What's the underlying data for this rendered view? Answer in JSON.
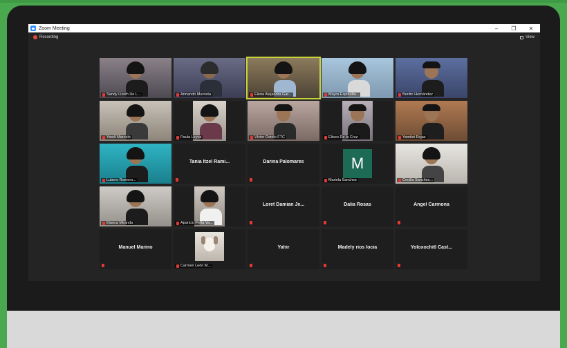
{
  "window": {
    "title": "Zoom Meeting",
    "min": "–",
    "max": "❐",
    "close": "✕"
  },
  "toolbar": {
    "recording": "Recording",
    "view": "View"
  },
  "participants": [
    "Sandy Lizeth De L...",
    "Armando Murrieta",
    "Elena Alejandra Gar...",
    "Mayra Espinoba...",
    "Benito Hernández",
    "Yareli Marcelo",
    "Paula Leyva",
    "Víctor Ostrilo FTC",
    "Eliseo De la Cruz",
    "Yamilet Rojas",
    "Lubero Romero...",
    "Tania Itzel Rami...",
    "Darina Palomares",
    "Mariela Sanchez",
    "Cecilia Sanchez...",
    "Elanca Miranda",
    "Aparicio Peña Va...",
    "Loret Damian Je...",
    "Dalia Rosas",
    "Angel Carmona",
    "Manuel Marino",
    "Carmen León M...",
    "Yahir",
    "Madely rios locia",
    "Yoloxochitl Cast..."
  ],
  "avatar_letter": "M"
}
